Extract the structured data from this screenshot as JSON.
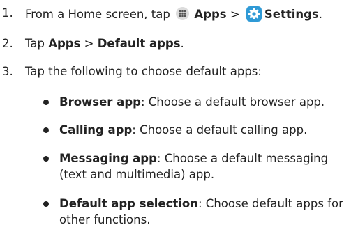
{
  "steps": [
    {
      "number": "1.",
      "prefix": "From a Home screen, tap",
      "apps_icon": "apps-grid-icon",
      "apps_label": "Apps",
      "separator": ">",
      "settings_icon": "settings-gear-icon",
      "settings_label": "Settings",
      "end": "."
    },
    {
      "number": "2.",
      "prefix": "Tap",
      "label_a": "Apps",
      "separator": ">",
      "label_b": "Default apps",
      "end": "."
    },
    {
      "number": "3.",
      "text": "Tap the following to choose default apps:"
    }
  ],
  "bullets": [
    {
      "term": "Browser app",
      "desc": ": Choose a default browser app."
    },
    {
      "term": "Calling app",
      "desc": ": Choose a default calling app."
    },
    {
      "term": "Messaging app",
      "desc": ": Choose a default messaging (text and multimedia) app."
    },
    {
      "term": "Default app selection",
      "desc": ": Choose default apps for other functions."
    }
  ],
  "colors": {
    "text": "#222222",
    "settings_icon_bg": "#2f9ad6",
    "apps_icon_bg": "#dcdcdc"
  }
}
